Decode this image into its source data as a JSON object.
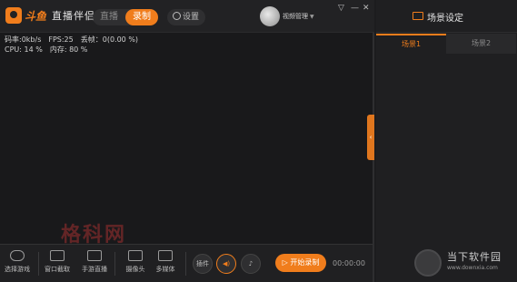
{
  "app": {
    "brand": "斗鱼",
    "name": "直播伴侣"
  },
  "mode": {
    "live": "直播",
    "record": "录制",
    "active": "record"
  },
  "settings_label": "设置",
  "video_manager": "视频管理",
  "window_controls": {
    "menu": "▽",
    "minimize": "—",
    "close": "✕"
  },
  "stats": {
    "bitrate": "码率:0kb/s",
    "fps": "FPS:25",
    "dropped": "丢帧：0(0.00 %)",
    "cpu": "CPU: 14 %",
    "memory": "内存: 80 %"
  },
  "collapse_icon": "chevron-left-icon",
  "collapse_glyph": "‹",
  "watermark": "格科网",
  "toolbar": {
    "tools": [
      {
        "label": "选择游戏",
        "icon": "gamepad-icon"
      },
      {
        "label": "窗口截取",
        "icon": "monitor-icon"
      },
      {
        "label": "手游直播",
        "icon": "mobile-screen-icon"
      },
      {
        "label": "摄像头",
        "icon": "camera-icon"
      },
      {
        "label": "多媒体",
        "icon": "media-icon"
      }
    ],
    "plugin": "插件",
    "speaker_glyph": "◀)",
    "mic_glyph": "♪",
    "start": "开始录制",
    "start_glyph": "▷",
    "timer": "00:00:00"
  },
  "side": {
    "title": "场景设定",
    "tabs": [
      "场景1",
      "场景2"
    ],
    "active_tab": 0
  },
  "branding": {
    "name": "当下软件园",
    "url": "www.downxia.com"
  },
  "colors": {
    "accent": "#f07d1c",
    "background": "#19191b",
    "panel": "#1f1f21"
  }
}
